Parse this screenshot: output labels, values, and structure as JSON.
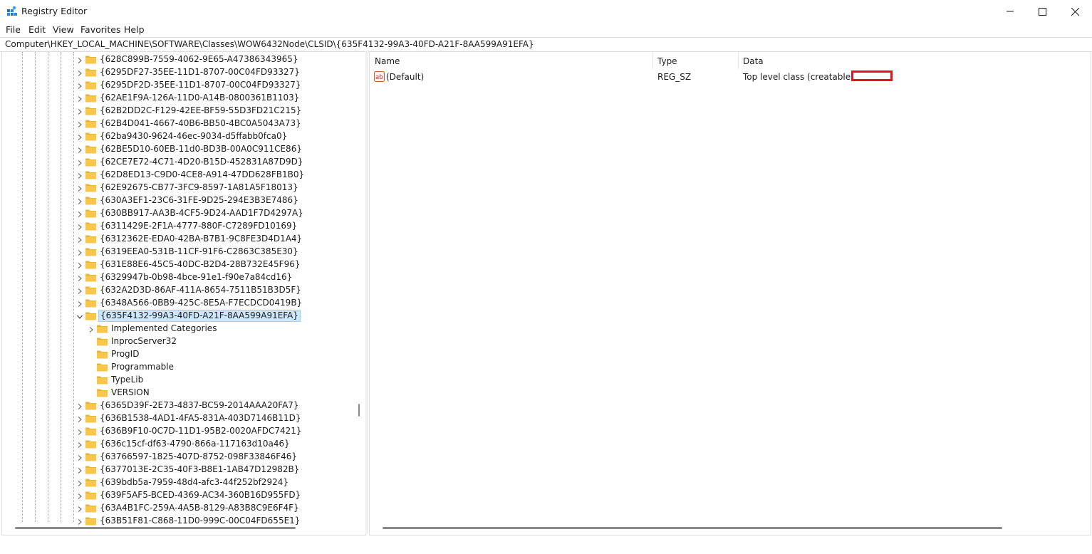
{
  "window": {
    "title": "Registry Editor"
  },
  "menu": [
    "File",
    "Edit",
    "View",
    "Favorites",
    "Help"
  ],
  "address": {
    "path": "Computer\\HKEY_LOCAL_MACHINE\\SOFTWARE\\Classes\\WOW6432Node\\CLSID\\{635F4132-99A3-40FD-A21F-8AA599A91EFA}"
  },
  "tree": {
    "items": [
      "{628C899B-7559-4062-9E65-A47386343965}",
      "{6295DF27-35EE-11D1-8707-00C04FD93327}",
      "{6295DF2D-35EE-11D1-8707-00C04FD93327}",
      "{62AE1F9A-126A-11D0-A14B-0800361B1103}",
      "{62B2DD2C-F129-42EE-BF59-55D3FD21C215}",
      "{62B4D041-4667-40B6-BB50-4BC0A5043A73}",
      "{62ba9430-9624-46ec-9034-d5ffabb0fca0}",
      "{62BE5D10-60EB-11d0-BD3B-00A0C911CE86}",
      "{62CE7E72-4C71-4D20-B15D-452831A87D9D}",
      "{62D8ED13-C9D0-4CE8-A914-47DD628FB1B0}",
      "{62E92675-CB77-3FC9-8597-1A81A5F18013}",
      "{630A3EF1-23C6-31FE-9D25-294E3B3E7486}",
      "{630BB917-AA3B-4CF5-9D24-AAD1F7D4297A}",
      "{6311429E-2F1A-4777-880F-C7289FD10169}",
      "{6312362E-EDA0-42BA-B7B1-9C8FE3D4D1A4}",
      "{6319EEA0-531B-11CF-91F6-C2863C385E30}",
      "{631E88E6-45C5-40DC-B2D4-28B732E45F96}",
      "{6329947b-0b98-4bce-91e1-f90e7a84cd16}",
      "{632A2D3D-86AF-411A-8654-7511B51B3D5F}",
      "{6348A566-0BB9-425C-8E5A-F7ECDCD0419B}"
    ],
    "selected": "{635F4132-99A3-40FD-A21F-8AA599A91EFA}",
    "children": [
      {
        "label": "Implemented Categories",
        "expandable": true
      },
      {
        "label": "InprocServer32",
        "expandable": false
      },
      {
        "label": "ProgID",
        "expandable": false
      },
      {
        "label": "Programmable",
        "expandable": false
      },
      {
        "label": "TypeLib",
        "expandable": false
      },
      {
        "label": "VERSION",
        "expandable": false
      }
    ],
    "items_after": [
      "{6365D39F-2E73-4837-BC59-2014AAA20FA7}",
      "{636B1538-4AD1-4FA5-831A-403D7146B11D}",
      "{636B9F10-0C7D-11D1-95B2-0020AFDC7421}",
      "{636c15cf-df63-4790-866a-117163d10a46}",
      "{63766597-1825-407D-8752-098F33846F46}",
      "{6377013E-2C35-40F3-B8E1-1AB47D12982B}",
      "{639bdb5a-7959-48d4-afc3-44f252bf2924}",
      "{639F5AF5-BCED-4369-AC34-360B16D955FD}",
      "{63A4B1FC-259A-4A5B-8129-A83B8C9E6F4F}",
      "{63B51F81-C868-11D0-999C-00C04FD655E1}"
    ]
  },
  "list": {
    "columns": [
      "Name",
      "Type",
      "Data"
    ],
    "rows": [
      {
        "name": "(Default)",
        "type": "REG_SZ",
        "data": "Top level class (creatable) for"
      }
    ]
  },
  "colors": {
    "selection_bg": "#cce8ff",
    "selection_border": "#99d1ff",
    "folder": "#f8c74a",
    "redaction": "#e0161e"
  },
  "icons": {
    "app": "registry-editor-icon",
    "folder": "folder-icon",
    "value": "string-value-icon"
  }
}
